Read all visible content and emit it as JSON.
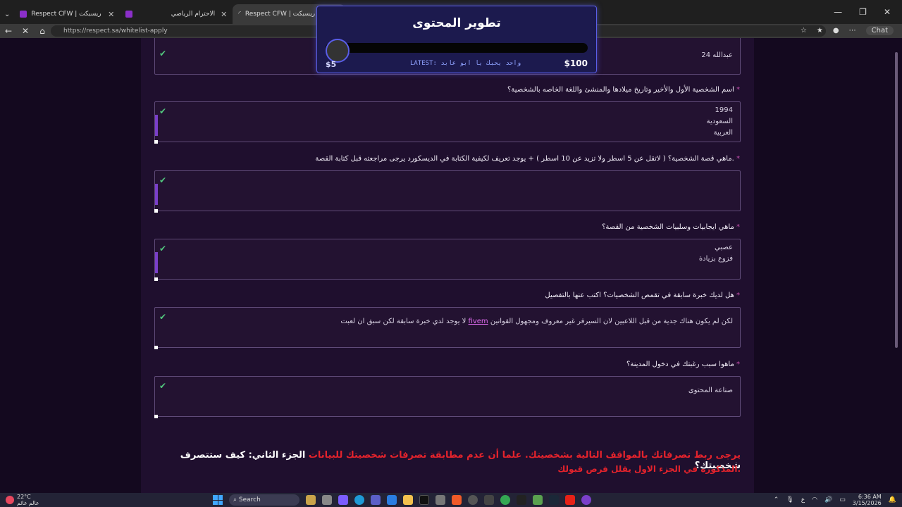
{
  "browser": {
    "tabs": [
      {
        "label": "Respect CFW | ريسبكت",
        "color": "#8b2fc9",
        "active": false
      },
      {
        "label": "الاحترام الرياضي",
        "color": "#8b2fc9",
        "active": false
      },
      {
        "label": "Respect CFW | ريسبكت",
        "color": "#999999",
        "active": true
      }
    ],
    "new_tab": "+",
    "url": "https://respect.sa/whitelist-apply",
    "chat_label": "Chat"
  },
  "form": {
    "first_field_value": "عبدالله 24",
    "questions": [
      {
        "label": "اسم الشخصية الأول والأخير وتاريخ ميلادها والمنشئ واللغة الخاصه بالشخصية؟",
        "value": "1994\nالسعودية\nالعربية"
      },
      {
        "label": "ماهي قصة الشخصية؟ ( لاتقل عن 5 اسطر ولا تزيد عن 10 اسطر ) + يوجد تعريف لكيفية الكتابة في الديسكورد يرجى مراجعته قبل كتابة القصة.",
        "value": ""
      },
      {
        "label": "ماهي ايجابيات وسلبيات الشخصية من القصة؟",
        "value": "عصبي\nفزوع بزيادة"
      },
      {
        "label": "هل لديك خبرة سابقة في تقمص الشخصيات؟ اكتب عنها بالتفصيل",
        "value_before": "لا يوجد لدي خبرة سابقة لكن سبق ان لعبت ",
        "value_link": "fivem",
        "value_after": " لكن لم يكون هناك جدية من قبل اللاعبين لان السيرفر غير معروف ومجهول القوانين"
      },
      {
        "label": "ماهوا سبب رغبتك في دخول المدينة؟",
        "value": "صناعة المحتوى"
      }
    ],
    "required_mark": "*",
    "part2_title": "الجزء الثاني: كيف ستتصرف شخصيتك؟",
    "part2_red": "يرجى ربط تصرفاتك بالمواقف التالية بشخصيتك. علما أن عدم مطابقة تصرفات شخصيتك للبيانات",
    "part2_note": "المذكوره في الجزء الاول يقلل فرص قبولك."
  },
  "overlay": {
    "title": "تطوير المحتوى",
    "min": "$5",
    "max": "$100",
    "latest": "LATEST: واحد يحبك يا ابو عابد",
    "progress": 0
  },
  "taskbar": {
    "temp": "22°C",
    "weather_desc": "عالم غائم",
    "search_label": "Search",
    "time": "6:36 AM",
    "date": "3/15/2026",
    "lang": "ع"
  }
}
